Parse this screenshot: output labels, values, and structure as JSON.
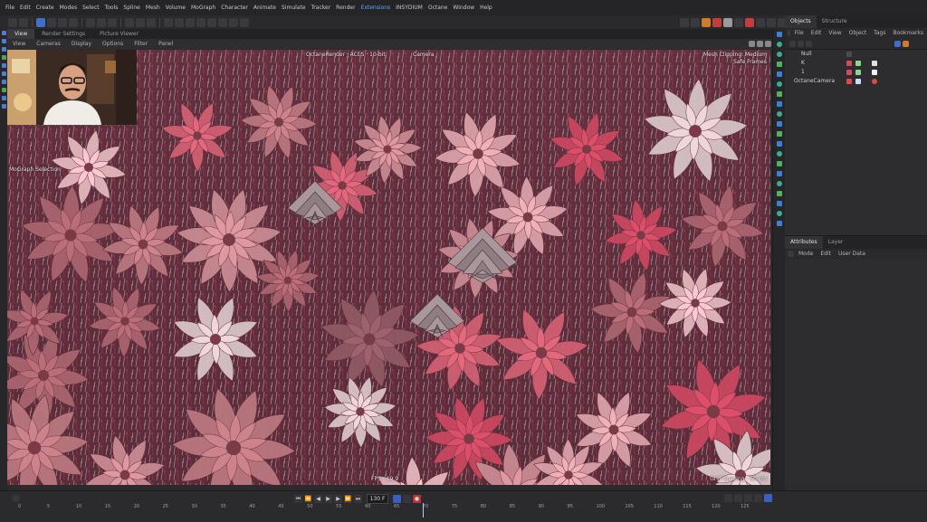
{
  "menubar": {
    "items": [
      "File",
      "Edit",
      "Create",
      "Modes",
      "Select",
      "Tools",
      "Spline",
      "Mesh",
      "Volume",
      "MoGraph",
      "Character",
      "Animate",
      "Simulate",
      "Tracker",
      "Render",
      "Extensions",
      "INSYDIUM",
      "Octane",
      "Window",
      "Help"
    ],
    "highlight": [
      "Extensions"
    ]
  },
  "tabs": {
    "items": [
      "View",
      "Render Settings",
      "Picture Viewer"
    ],
    "active": "View"
  },
  "viewport_menu": {
    "items": [
      "View",
      "Cameras",
      "Display",
      "Options",
      "Filter",
      "Panel"
    ]
  },
  "viewport": {
    "hud_top": "OctaneRender · ACES · 10-bit",
    "hud_camera": "Camera",
    "clipping": "Mesh Clipping: Medium",
    "safe_frames": "Safe Frames",
    "selection_label": "MoGraph Selection",
    "fps": "FPS : 19.9",
    "grid_spacing": "Grid Spacing : 50 cm"
  },
  "object_panel": {
    "tabs": [
      "Objects",
      "Structure"
    ],
    "menu": [
      "File",
      "Edit",
      "View",
      "Object",
      "Tags",
      "Bookmarks"
    ],
    "objects": [
      {
        "name": "Null",
        "color": "#b9b9bd"
      },
      {
        "name": "K",
        "color": "#d8485e"
      },
      {
        "name": "1",
        "color": "#d8485e"
      },
      {
        "name": "OctaneCamera",
        "color": "#e04848"
      }
    ]
  },
  "attr_panel": {
    "tabs": [
      "Attributes",
      "Layer"
    ],
    "menu": [
      "Mode",
      "Edit",
      "User Data"
    ]
  },
  "timeline": {
    "current_frame": "130 F",
    "ticks": [
      "0",
      "5",
      "10",
      "15",
      "20",
      "25",
      "30",
      "35",
      "40",
      "45",
      "50",
      "55",
      "60",
      "65",
      "70",
      "75",
      "80",
      "85",
      "90",
      "95",
      "100",
      "105",
      "110",
      "115",
      "120",
      "125"
    ],
    "playhead_frame": 70
  },
  "colors": {
    "accent": "#63a8ff",
    "petal": "#c98a92",
    "background": "#2b2b2d"
  }
}
